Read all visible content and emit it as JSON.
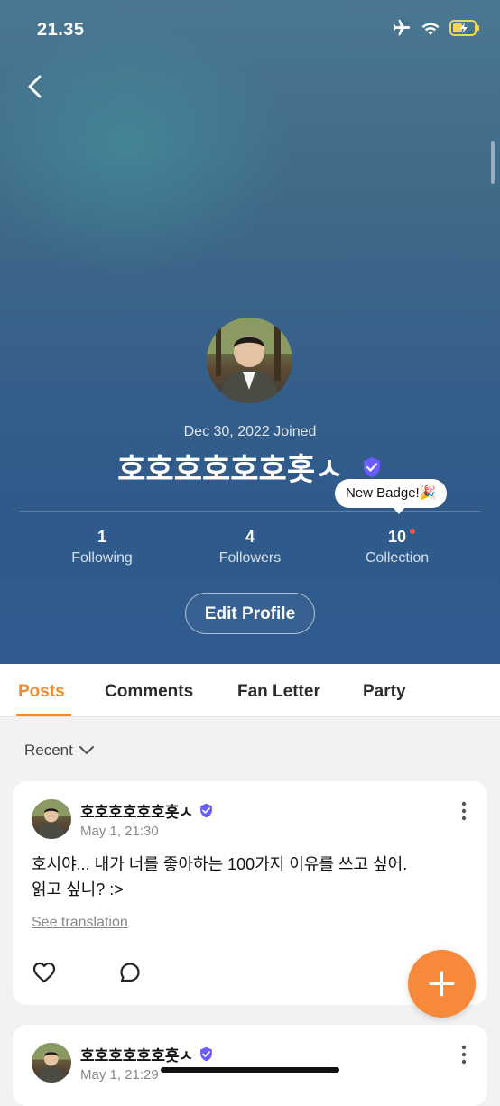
{
  "status_bar": {
    "time": "21.35"
  },
  "profile": {
    "joined": "Dec 30, 2022 Joined",
    "username": "호호호호호호홋ㅅ",
    "badge_tooltip": "New Badge!🎉",
    "stats": [
      {
        "value": "1",
        "label": "Following"
      },
      {
        "value": "4",
        "label": "Followers"
      },
      {
        "value": "10",
        "label": "Collection"
      }
    ],
    "edit_button": "Edit Profile"
  },
  "tabs": [
    {
      "label": "Posts",
      "active": true
    },
    {
      "label": "Comments",
      "active": false
    },
    {
      "label": "Fan Letter",
      "active": false
    },
    {
      "label": "Party",
      "active": false
    }
  ],
  "sort": {
    "label": "Recent"
  },
  "posts": [
    {
      "author": "호호호호호호홋ㅅ",
      "date": "May 1, 21:30",
      "line1": "호시야... 내가 너를 좋아하는 100가지 이유를 쓰고 싶어.",
      "line2": "읽고 싶니? :>",
      "translate": "See translation"
    },
    {
      "author": "호호호호호호홋ㅅ",
      "date": "May 1, 21:29"
    }
  ],
  "colors": {
    "accent": "#f28a33",
    "fab": "#f6893a",
    "verified": "#6a5cff"
  }
}
